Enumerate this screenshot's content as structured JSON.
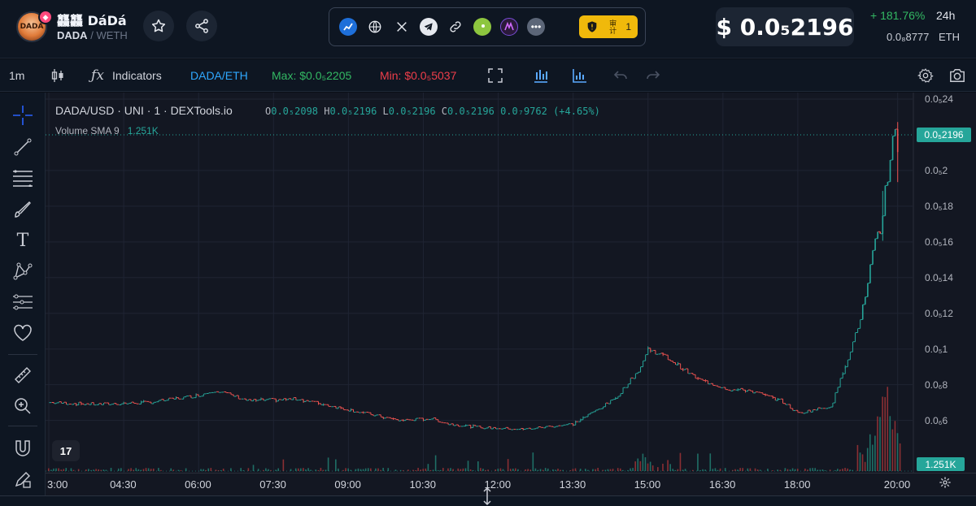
{
  "token": {
    "name": "龘龘 DáDá",
    "base": "DADA",
    "sep": "/",
    "quote": "WETH",
    "logo_text": "DADA"
  },
  "social": {
    "icons": [
      "dextools-icon",
      "globe-icon",
      "x-icon",
      "telegram-icon",
      "link-icon",
      "coingecko-icon",
      "dapp-icon",
      "more-icon"
    ],
    "audit_label": "审计",
    "audit_count": "1"
  },
  "price": {
    "usd": "$ 0.0₅2196",
    "change_24h": "+ 181.76%",
    "period": "24h",
    "eth": "0.0₈8777",
    "eth_unit": "ETH"
  },
  "toolbar": {
    "interval": "1m",
    "indicators_label": "Indicators",
    "pair": "DADA/ETH",
    "max_label": "Max: $0.0₅2205",
    "min_label": "Min: $0.0₅5037"
  },
  "chart_legend": {
    "title": "DADA/USD · UNI · 1 · DEXTools.io",
    "o_label": "O",
    "o": "0.0₅2098",
    "h_label": "H",
    "h": "0.0₅2196",
    "l_label": "L",
    "l": "0.0₅2196",
    "c_label": "C",
    "c": "0.0₅2196",
    "change": "0.0₇9762 (+4.65%)",
    "volume_label": "Volume SMA 9",
    "volume_value": "1.251K",
    "tv_logo": "17"
  },
  "chart_data": {
    "type": "line",
    "price_axis_labels": [
      "0.0₅24",
      "0.0₅2",
      "0.0₅18",
      "0.0₅16",
      "0.0₅14",
      "0.0₅12",
      "0.0₅1",
      "0.0₆8",
      "0.0₆6"
    ],
    "current_price_tag": "0.0₅2196",
    "volume_tag": "1.251K",
    "time_labels": [
      "3:00",
      "04:30",
      "06:00",
      "07:30",
      "09:00",
      "10:30",
      "12:00",
      "13:30",
      "15:00",
      "16:30",
      "18:00",
      "20:00"
    ],
    "series": [
      {
        "x": [
          "03:00",
          "04:00",
          "05:00",
          "06:00",
          "06:20",
          "07:00",
          "08:00",
          "09:00",
          "10:00",
          "10:40",
          "11:00",
          "11:40",
          "12:30",
          "13:30",
          "14:20",
          "14:50",
          "15:00",
          "15:20",
          "16:00",
          "16:40",
          "17:00",
          "17:40",
          "18:00",
          "18:40",
          "19:00",
          "19:20",
          "19:40",
          "19:50",
          "20:00"
        ],
        "y": [
          7e-06,
          6.9e-06,
          7e-06,
          7.4e-06,
          7.7e-06,
          7.1e-06,
          7.2e-06,
          6.6e-06,
          6e-06,
          6.1e-06,
          5.8e-06,
          5.6e-06,
          5.5e-06,
          5.8e-06,
          7.2e-06,
          8.9e-06,
          1e-05,
          9.6e-06,
          8.3e-06,
          7.7e-06,
          7.7e-06,
          7.1e-06,
          6.4e-06,
          6.8e-06,
          9.5e-06,
          1.24e-05,
          1.7e-05,
          2.1e-05,
          2.2e-05
        ]
      }
    ],
    "colors": {
      "up": "#26a69a",
      "down": "#ef5350",
      "volume_up": "#1f6f66",
      "volume_down": "#8a2f33"
    }
  }
}
